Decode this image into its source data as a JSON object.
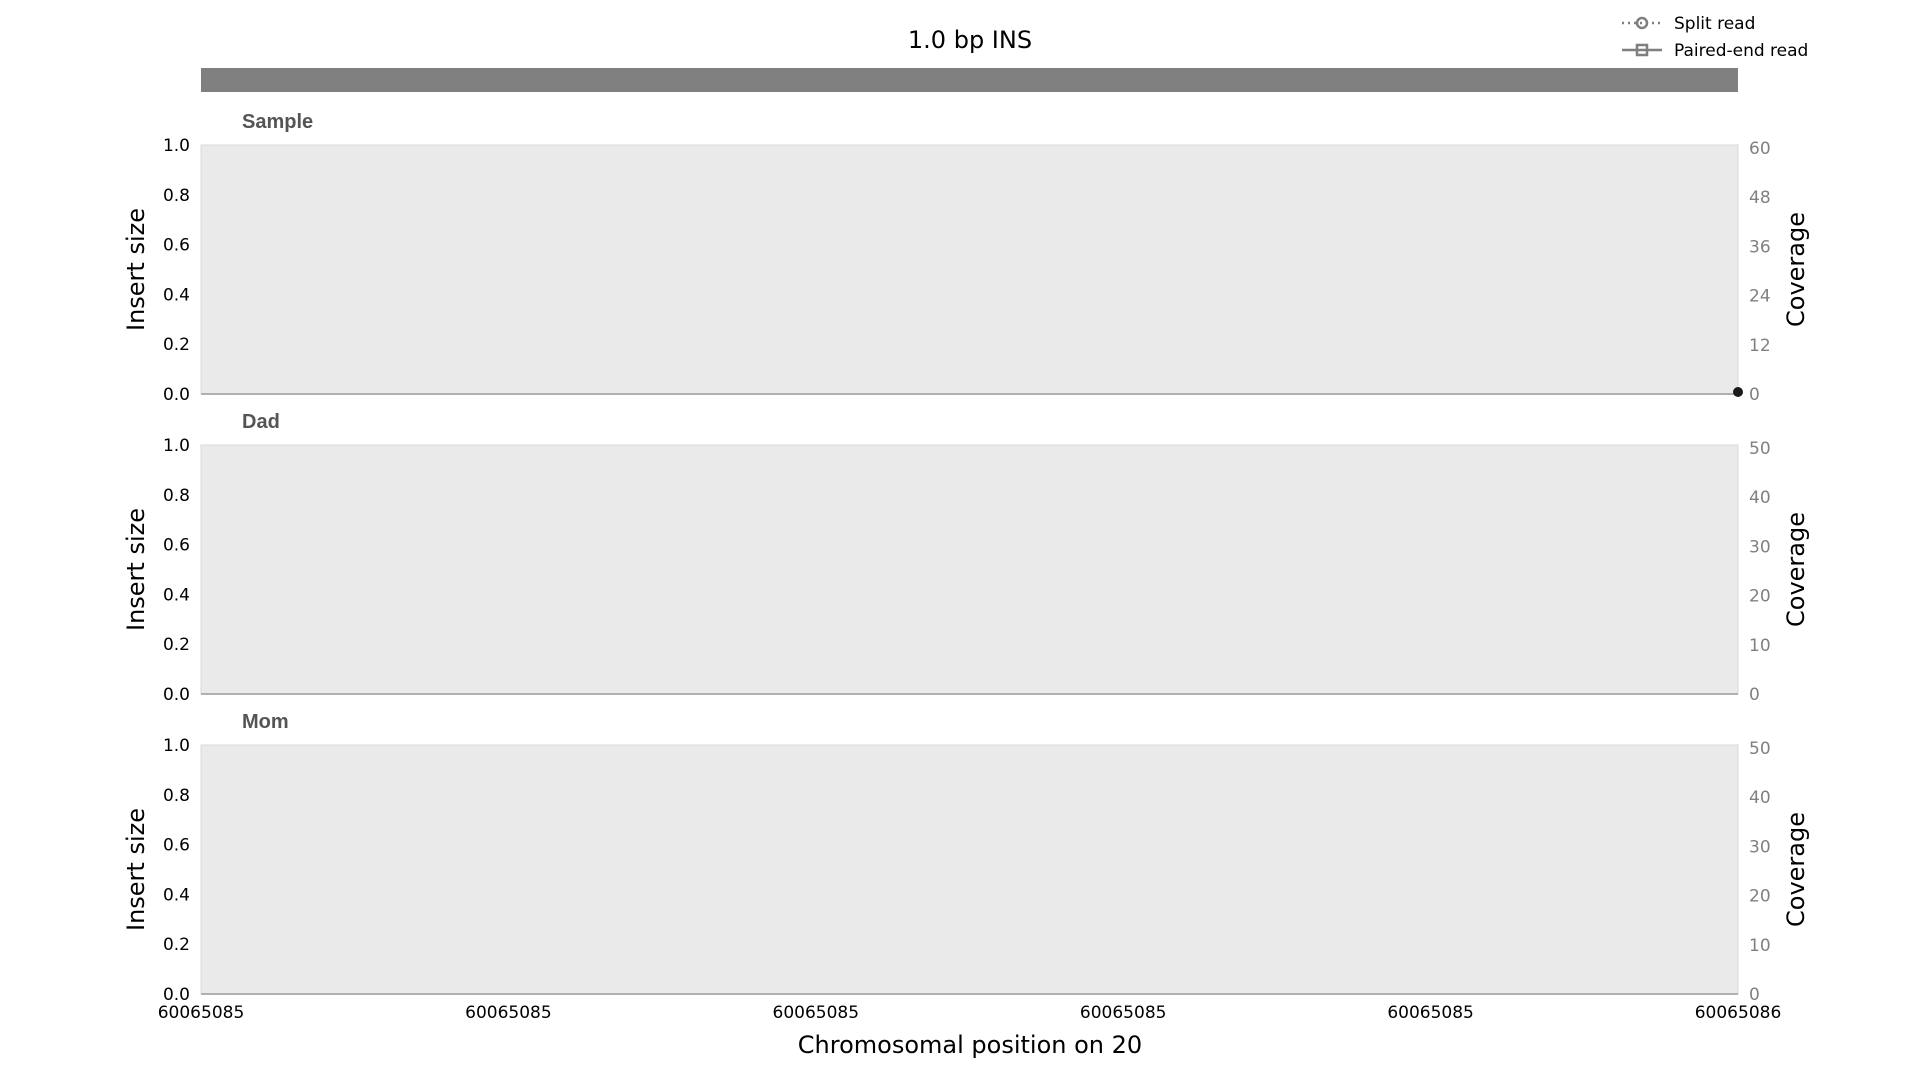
{
  "chart_data": {
    "type": "line",
    "title": "1.0 bp INS",
    "xlabel": "Chromosomal position on 20",
    "x_ticks": [
      "60065085",
      "60065085",
      "60065085",
      "60065085",
      "60065085",
      "60065086"
    ],
    "xlim": [
      60065085,
      60065086
    ],
    "legend": {
      "placement": "top-right",
      "entries": [
        {
          "label": "Split read",
          "style": "dotted",
          "marker": "circle"
        },
        {
          "label": "Paired-end read",
          "style": "solid",
          "marker": "square"
        }
      ]
    },
    "panels": [
      {
        "name": "Sample",
        "ylabel_left": "Insert size",
        "ylabel_right": "Coverage",
        "left_ticks": [
          "0.0",
          "0.2",
          "0.4",
          "0.6",
          "0.8",
          "1.0"
        ],
        "right_ticks": [
          "0",
          "12",
          "24",
          "36",
          "48",
          "60"
        ],
        "ylim": [
          0,
          1
        ],
        "coverage_lim": [
          0,
          60
        ],
        "points": [
          {
            "x": 60065086,
            "y": 0
          }
        ]
      },
      {
        "name": "Dad",
        "ylabel_left": "Insert size",
        "ylabel_right": "Coverage",
        "left_ticks": [
          "0.0",
          "0.2",
          "0.4",
          "0.6",
          "0.8",
          "1.0"
        ],
        "right_ticks": [
          "0",
          "10",
          "20",
          "30",
          "40",
          "50"
        ],
        "ylim": [
          0,
          1
        ],
        "coverage_lim": [
          0,
          50
        ],
        "points": []
      },
      {
        "name": "Mom",
        "ylabel_left": "Insert size",
        "ylabel_right": "Coverage",
        "left_ticks": [
          "0.0",
          "0.2",
          "0.4",
          "0.6",
          "0.8",
          "1.0"
        ],
        "right_ticks": [
          "0",
          "10",
          "20",
          "30",
          "40",
          "50"
        ],
        "ylim": [
          0,
          1
        ],
        "coverage_lim": [
          0,
          50
        ],
        "points": []
      }
    ],
    "colors": {
      "panel_bg": "#eaeaea",
      "variant_bar": "#808080",
      "legend_line": "#7f7f7f",
      "point": "#1a1a1a",
      "right_tick": "#808080"
    }
  }
}
